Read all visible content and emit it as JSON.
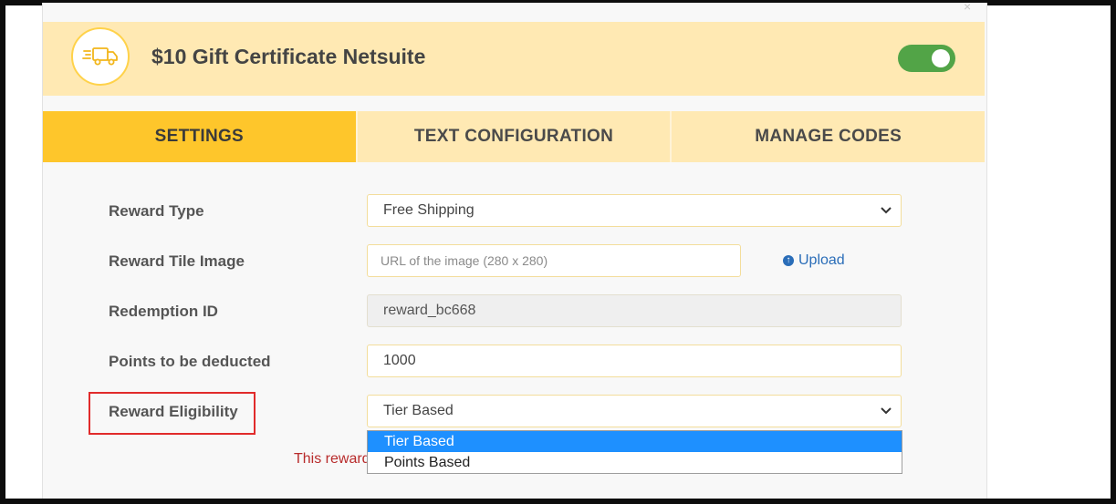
{
  "header": {
    "title": "$10 Gift Certificate Netsuite",
    "icon": "delivery-truck-icon",
    "enabled": true
  },
  "tabs": [
    {
      "label": "SETTINGS",
      "active": true
    },
    {
      "label": "TEXT CONFIGURATION",
      "active": false
    },
    {
      "label": "MANAGE CODES",
      "active": false
    }
  ],
  "form": {
    "reward_type": {
      "label": "Reward Type",
      "value": "Free Shipping"
    },
    "tile_image": {
      "label": "Reward Tile Image",
      "placeholder": "URL of the image (280 x 280)",
      "upload_label": "Upload"
    },
    "redemption_id": {
      "label": "Redemption ID",
      "value": "reward_bc668"
    },
    "points": {
      "label": "Points to be deducted",
      "value": "1000"
    },
    "eligibility": {
      "label": "Reward Eligibility",
      "value": "Tier Based",
      "options": [
        "Tier Based",
        "Points Based"
      ]
    }
  },
  "warning_text": "This reward",
  "colors": {
    "accent": "#fec62b",
    "header_bg": "#ffe9b3",
    "toggle_on": "#52a447",
    "link": "#2a6db8",
    "highlight": "#e12b2b",
    "selected_option": "#1e90ff"
  }
}
